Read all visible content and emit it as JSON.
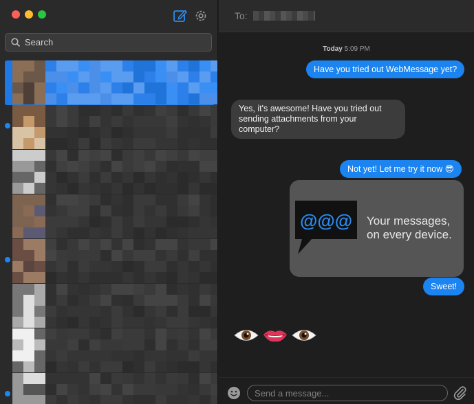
{
  "window": {
    "controls": [
      "close",
      "minimize",
      "maximize"
    ],
    "accent_color": "#1b84f1"
  },
  "sidebar": {
    "compose_icon": "compose-icon",
    "settings_icon": "gear-icon",
    "search": {
      "placeholder": "Search",
      "icon": "search-icon"
    },
    "conversations": [
      {
        "selected": true,
        "unread": false
      },
      {
        "selected": false,
        "unread": true
      },
      {
        "selected": false,
        "unread": false
      },
      {
        "selected": false,
        "unread": false
      },
      {
        "selected": false,
        "unread": true
      },
      {
        "selected": false,
        "unread": false
      },
      {
        "selected": false,
        "unread": false
      },
      {
        "selected": false,
        "unread": true
      }
    ]
  },
  "header": {
    "to_label": "To:"
  },
  "thread": {
    "timestamp_day": "Today",
    "timestamp_time": "5:09 PM",
    "messages": [
      {
        "direction": "outgoing",
        "text": "Have you tried out WebMessage yet?"
      },
      {
        "direction": "incoming",
        "text": "Yes, it's awesome! Have you tried out sending attachments from your computer?"
      },
      {
        "direction": "outgoing",
        "text": "Not yet! Let me try it now 😎"
      },
      {
        "direction": "outgoing",
        "type": "image",
        "image_text": "@@@",
        "caption_line1": "Your messages,",
        "caption_line2": "on every device."
      },
      {
        "direction": "outgoing",
        "text": "Sweet!"
      },
      {
        "direction": "incoming",
        "type": "emoji",
        "icons": [
          "eye-icon",
          "lips-icon",
          "eye-icon"
        ]
      }
    ]
  },
  "composer": {
    "placeholder": "Send a message...",
    "emoji_icon": "smile-icon",
    "attach_icon": "paperclip-icon"
  }
}
